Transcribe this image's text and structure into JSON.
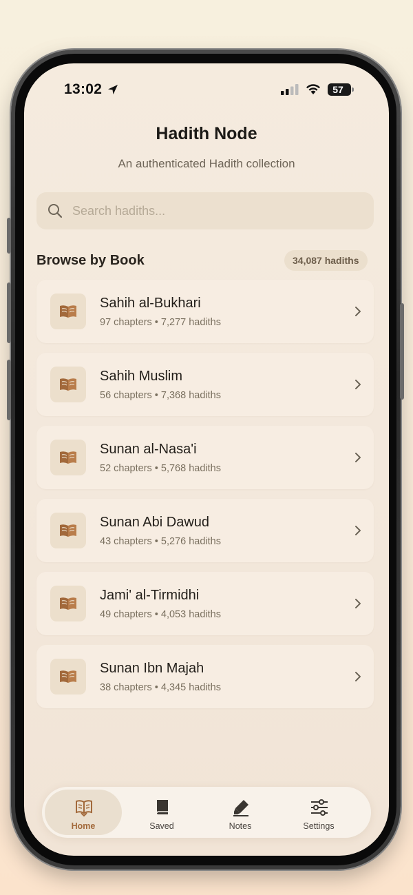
{
  "status_bar": {
    "time": "13:02",
    "battery": "57"
  },
  "header": {
    "title": "Hadith Node",
    "subtitle": "An authenticated Hadith collection"
  },
  "search": {
    "placeholder": "Search hadiths...",
    "value": ""
  },
  "browse": {
    "title": "Browse by Book",
    "total_badge": "34,087 hadiths",
    "books": [
      {
        "name": "Sahih al-Bukhari",
        "meta": "97 chapters • 7,277 hadiths",
        "icon": "open-book-icon"
      },
      {
        "name": "Sahih Muslim",
        "meta": "56 chapters • 7,368 hadiths",
        "icon": "open-book-icon"
      },
      {
        "name": "Sunan al-Nasa'i",
        "meta": "52 chapters • 5,768 hadiths",
        "icon": "open-book-icon"
      },
      {
        "name": "Sunan Abi Dawud",
        "meta": "43 chapters • 5,276 hadiths",
        "icon": "open-book-icon"
      },
      {
        "name": "Jami' al-Tirmidhi",
        "meta": "49 chapters • 4,053 hadiths",
        "icon": "open-book-icon"
      },
      {
        "name": "Sunan Ibn Majah",
        "meta": "38 chapters • 4,345 hadiths",
        "icon": "open-book-icon"
      }
    ]
  },
  "tabbar": {
    "tabs": [
      {
        "label": "Home",
        "icon": "book-reader-icon",
        "active": true
      },
      {
        "label": "Saved",
        "icon": "bookmark-book-icon",
        "active": false
      },
      {
        "label": "Notes",
        "icon": "highlighter-icon",
        "active": false
      },
      {
        "label": "Settings",
        "icon": "sliders-icon",
        "active": false
      }
    ]
  },
  "colors": {
    "accent": "#a2693b",
    "background": "#f4e9dc",
    "card": "#f7ede2",
    "text_primary": "#231f1a",
    "text_secondary": "#7a705f"
  }
}
